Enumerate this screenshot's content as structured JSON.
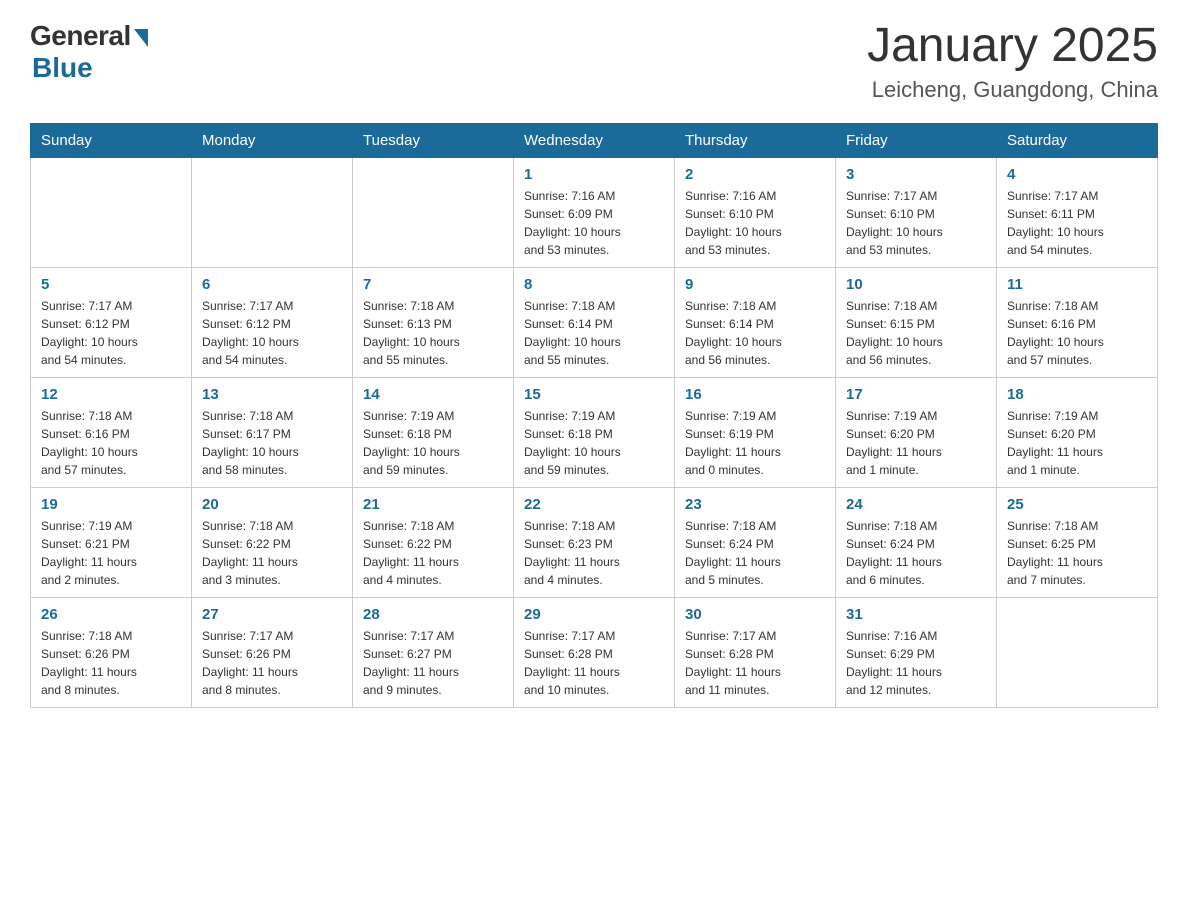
{
  "logo": {
    "general": "General",
    "blue": "Blue"
  },
  "title": "January 2025",
  "location": "Leicheng, Guangdong, China",
  "days_of_week": [
    "Sunday",
    "Monday",
    "Tuesday",
    "Wednesday",
    "Thursday",
    "Friday",
    "Saturday"
  ],
  "weeks": [
    [
      {
        "day": "",
        "info": ""
      },
      {
        "day": "",
        "info": ""
      },
      {
        "day": "",
        "info": ""
      },
      {
        "day": "1",
        "info": "Sunrise: 7:16 AM\nSunset: 6:09 PM\nDaylight: 10 hours\nand 53 minutes."
      },
      {
        "day": "2",
        "info": "Sunrise: 7:16 AM\nSunset: 6:10 PM\nDaylight: 10 hours\nand 53 minutes."
      },
      {
        "day": "3",
        "info": "Sunrise: 7:17 AM\nSunset: 6:10 PM\nDaylight: 10 hours\nand 53 minutes."
      },
      {
        "day": "4",
        "info": "Sunrise: 7:17 AM\nSunset: 6:11 PM\nDaylight: 10 hours\nand 54 minutes."
      }
    ],
    [
      {
        "day": "5",
        "info": "Sunrise: 7:17 AM\nSunset: 6:12 PM\nDaylight: 10 hours\nand 54 minutes."
      },
      {
        "day": "6",
        "info": "Sunrise: 7:17 AM\nSunset: 6:12 PM\nDaylight: 10 hours\nand 54 minutes."
      },
      {
        "day": "7",
        "info": "Sunrise: 7:18 AM\nSunset: 6:13 PM\nDaylight: 10 hours\nand 55 minutes."
      },
      {
        "day": "8",
        "info": "Sunrise: 7:18 AM\nSunset: 6:14 PM\nDaylight: 10 hours\nand 55 minutes."
      },
      {
        "day": "9",
        "info": "Sunrise: 7:18 AM\nSunset: 6:14 PM\nDaylight: 10 hours\nand 56 minutes."
      },
      {
        "day": "10",
        "info": "Sunrise: 7:18 AM\nSunset: 6:15 PM\nDaylight: 10 hours\nand 56 minutes."
      },
      {
        "day": "11",
        "info": "Sunrise: 7:18 AM\nSunset: 6:16 PM\nDaylight: 10 hours\nand 57 minutes."
      }
    ],
    [
      {
        "day": "12",
        "info": "Sunrise: 7:18 AM\nSunset: 6:16 PM\nDaylight: 10 hours\nand 57 minutes."
      },
      {
        "day": "13",
        "info": "Sunrise: 7:18 AM\nSunset: 6:17 PM\nDaylight: 10 hours\nand 58 minutes."
      },
      {
        "day": "14",
        "info": "Sunrise: 7:19 AM\nSunset: 6:18 PM\nDaylight: 10 hours\nand 59 minutes."
      },
      {
        "day": "15",
        "info": "Sunrise: 7:19 AM\nSunset: 6:18 PM\nDaylight: 10 hours\nand 59 minutes."
      },
      {
        "day": "16",
        "info": "Sunrise: 7:19 AM\nSunset: 6:19 PM\nDaylight: 11 hours\nand 0 minutes."
      },
      {
        "day": "17",
        "info": "Sunrise: 7:19 AM\nSunset: 6:20 PM\nDaylight: 11 hours\nand 1 minute."
      },
      {
        "day": "18",
        "info": "Sunrise: 7:19 AM\nSunset: 6:20 PM\nDaylight: 11 hours\nand 1 minute."
      }
    ],
    [
      {
        "day": "19",
        "info": "Sunrise: 7:19 AM\nSunset: 6:21 PM\nDaylight: 11 hours\nand 2 minutes."
      },
      {
        "day": "20",
        "info": "Sunrise: 7:18 AM\nSunset: 6:22 PM\nDaylight: 11 hours\nand 3 minutes."
      },
      {
        "day": "21",
        "info": "Sunrise: 7:18 AM\nSunset: 6:22 PM\nDaylight: 11 hours\nand 4 minutes."
      },
      {
        "day": "22",
        "info": "Sunrise: 7:18 AM\nSunset: 6:23 PM\nDaylight: 11 hours\nand 4 minutes."
      },
      {
        "day": "23",
        "info": "Sunrise: 7:18 AM\nSunset: 6:24 PM\nDaylight: 11 hours\nand 5 minutes."
      },
      {
        "day": "24",
        "info": "Sunrise: 7:18 AM\nSunset: 6:24 PM\nDaylight: 11 hours\nand 6 minutes."
      },
      {
        "day": "25",
        "info": "Sunrise: 7:18 AM\nSunset: 6:25 PM\nDaylight: 11 hours\nand 7 minutes."
      }
    ],
    [
      {
        "day": "26",
        "info": "Sunrise: 7:18 AM\nSunset: 6:26 PM\nDaylight: 11 hours\nand 8 minutes."
      },
      {
        "day": "27",
        "info": "Sunrise: 7:17 AM\nSunset: 6:26 PM\nDaylight: 11 hours\nand 8 minutes."
      },
      {
        "day": "28",
        "info": "Sunrise: 7:17 AM\nSunset: 6:27 PM\nDaylight: 11 hours\nand 9 minutes."
      },
      {
        "day": "29",
        "info": "Sunrise: 7:17 AM\nSunset: 6:28 PM\nDaylight: 11 hours\nand 10 minutes."
      },
      {
        "day": "30",
        "info": "Sunrise: 7:17 AM\nSunset: 6:28 PM\nDaylight: 11 hours\nand 11 minutes."
      },
      {
        "day": "31",
        "info": "Sunrise: 7:16 AM\nSunset: 6:29 PM\nDaylight: 11 hours\nand 12 minutes."
      },
      {
        "day": "",
        "info": ""
      }
    ]
  ]
}
